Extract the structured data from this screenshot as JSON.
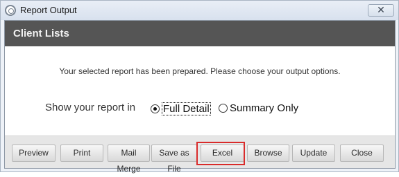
{
  "window": {
    "title": "Report Output",
    "close_glyph": "✕"
  },
  "header": {
    "title": "Client Lists"
  },
  "main": {
    "message": "Your selected report has been prepared. Please choose your output options.",
    "show_label": "Show your report in",
    "radio_options": [
      {
        "label": "Full Detail",
        "selected": true
      },
      {
        "label": "Summary Only",
        "selected": false
      }
    ]
  },
  "footer": {
    "buttons": [
      {
        "label": "Preview"
      },
      {
        "label": "Print"
      },
      {
        "label": "Mail Merge"
      },
      {
        "label": "Save as File"
      },
      {
        "label": "Excel"
      },
      {
        "label": "Browse"
      },
      {
        "label": "Update"
      },
      {
        "label": "Close"
      }
    ]
  },
  "annotation": {
    "highlight_color": "#d92b2b",
    "highlighted_button": "Excel"
  }
}
